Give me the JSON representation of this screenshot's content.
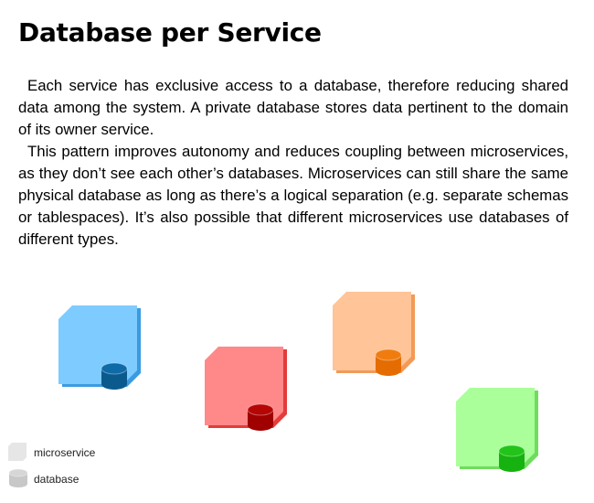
{
  "title": "Database per Service",
  "paragraphs": [
    "Each service has exclusive access to a database, therefore reducing shared data among the system. A private database stores data pertinent to the domain of its owner service.",
    "This pattern improves autonomy and reduces coupling between microservices, as they don’t see each other’s databases. Microservices can still share the same physical database as long as there’s a logical separation (e.g. separate schemas or tablespaces). It’s also possible that different microservices use databases of different types."
  ],
  "diagram": {
    "services": [
      {
        "id": "blue",
        "color": "#7dcbff",
        "shadow": "#3b9be0",
        "db_color": "#0b5a8e",
        "db_top": "#0f6aa8"
      },
      {
        "id": "red",
        "color": "#ff8888",
        "shadow": "#e43b3b",
        "db_color": "#a00000",
        "db_top": "#b50606"
      },
      {
        "id": "orange",
        "color": "#ffc497",
        "shadow": "#f29a57",
        "db_color": "#e56c00",
        "db_top": "#f07c10"
      },
      {
        "id": "green",
        "color": "#aaff9a",
        "shadow": "#6fdc5e",
        "db_color": "#16b20f",
        "db_top": "#22c41a"
      }
    ]
  },
  "legend": {
    "microservice_label": "microservice",
    "database_label": "database",
    "microservice_color": "#e6e6e6",
    "database_color": "#c8c8c8"
  }
}
